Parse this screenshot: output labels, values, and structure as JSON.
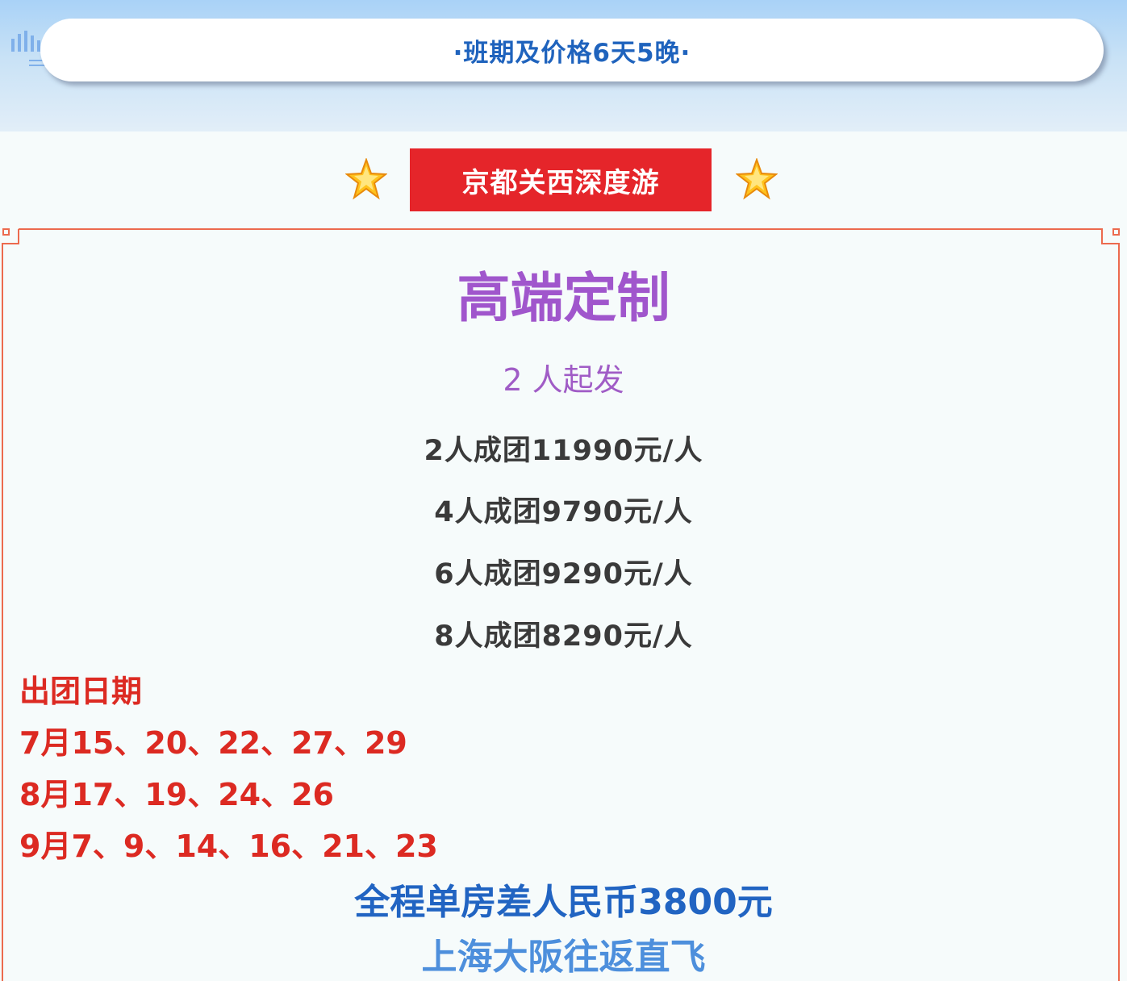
{
  "header": {
    "title": "·班期及价格6天5晚·"
  },
  "tour": {
    "name": "京都关西深度游",
    "headline": "高端定制",
    "min_people": "2 人起发",
    "prices": [
      "2人成团11990元/人",
      "4人成团9790元/人",
      "6人成团9290元/人",
      "8人成团8290元/人"
    ],
    "dates_title": "出团日期",
    "dates": [
      "7月15、20、22、27、29",
      "8月17、19、24、26",
      "9月7、9、14、16、21、23"
    ],
    "single_supplement": "全程单房差人民币3800元",
    "flight": "上海大阪往返直飞"
  },
  "colors": {
    "title_blue": "#1f63bd",
    "tag_red": "#e5252a",
    "headline_purple": "#a056cc",
    "date_red": "#dc2a22",
    "frame_orange": "#ec6a4e"
  }
}
